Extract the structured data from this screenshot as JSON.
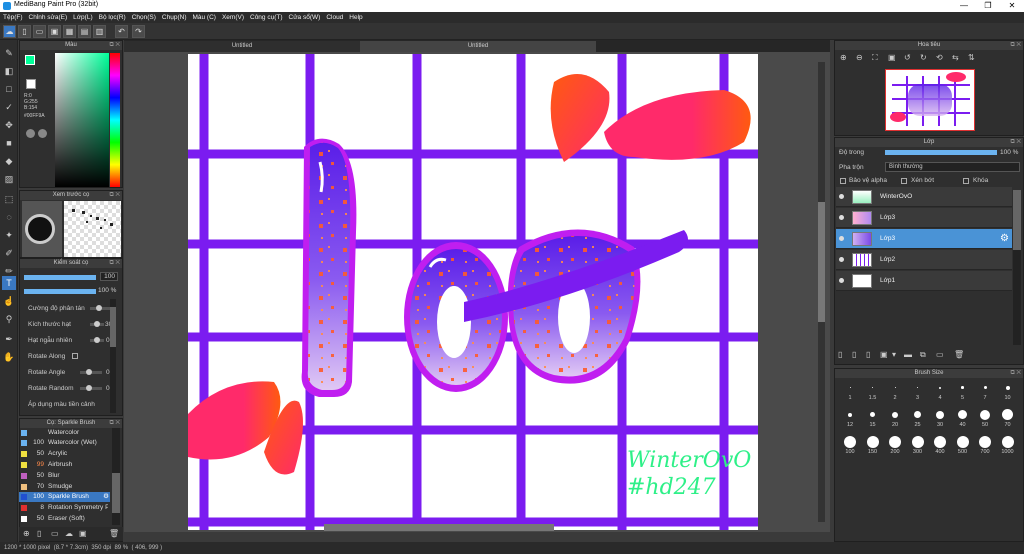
{
  "window": {
    "title": "MediBang Paint Pro (32bit)",
    "minimize": "—",
    "maximize": "❐",
    "close": "✕"
  },
  "menu": [
    "Tệp(F)",
    "Chỉnh sửa(E)",
    "Lớp(L)",
    "Bộ lọc(R)",
    "Chọn(S)",
    "Chụp(N)",
    "Màu (C)",
    "Xem(V)",
    "Công cụ(T)",
    "Cửa sổ(W)",
    "Cloud",
    "Help"
  ],
  "tabs": [
    "Untitled",
    "Untitled"
  ],
  "color_panel": {
    "title": "Màu",
    "r": "R:0",
    "g": "G:255",
    "b": "B:154",
    "hex": "#00FF9A"
  },
  "brush_preview": {
    "title": "Xem trước cọ"
  },
  "brush_control": {
    "title": "Kiểm soát cọ",
    "size_value": "100",
    "opacity_value": "100 %",
    "settings": [
      {
        "label": "Cường độ phân tán",
        "value": ""
      },
      {
        "label": "Kích thước hạt",
        "value": "30"
      },
      {
        "label": "Hạt ngẫu nhiên",
        "value": "0"
      },
      {
        "label": "Rotate Along",
        "value": ""
      },
      {
        "label": "Rotate Angle",
        "value": "0"
      },
      {
        "label": "Rotate Random",
        "value": "0"
      },
      {
        "label": "Áp dụng màu tiền cảnh",
        "value": ""
      }
    ]
  },
  "brush_list": {
    "title": "Cọ: Sparkle Brush",
    "items": [
      {
        "size": "",
        "name": "Watercolor",
        "color": "#6bb3f0"
      },
      {
        "size": "100",
        "name": "Watercolor (Wet)",
        "color": "#6bb3f0"
      },
      {
        "size": "50",
        "name": "Acrylic",
        "color": "#f0e040"
      },
      {
        "size": "99",
        "name": "Airbrush",
        "color": "#f0e040"
      },
      {
        "size": "50",
        "name": "Blur",
        "color": "#c060c0"
      },
      {
        "size": "70",
        "name": "Smudge",
        "color": "#f0c080"
      },
      {
        "size": "100",
        "name": "Sparkle Brush",
        "color": "#2050d0"
      },
      {
        "size": "8",
        "name": "Rotation Symmetry P",
        "color": "#e03030"
      },
      {
        "size": "50",
        "name": "Eraser (Soft)",
        "color": "#ffffff"
      }
    ]
  },
  "navigator": {
    "title": "Hoa tiêu"
  },
  "layers": {
    "title": "Lớp",
    "opacity_label": "Độ trong",
    "opacity_value": "100 %",
    "blend_label": "Pha trộn",
    "blend_value": "Bình thường",
    "protect_alpha": "Bảo vệ alpha",
    "clipping": "Xén bớt",
    "lock": "Khóa",
    "items": [
      {
        "name": "WinterOvO",
        "selected": false
      },
      {
        "name": "Lớp3",
        "selected": false
      },
      {
        "name": "Lớp3",
        "selected": true
      },
      {
        "name": "Lớp2",
        "selected": false
      },
      {
        "name": "Lớp1",
        "selected": false
      }
    ]
  },
  "brush_size": {
    "title": "Brush Size",
    "sizes": [
      "1",
      "1.5",
      "2",
      "3",
      "4",
      "5",
      "7",
      "10",
      "12",
      "15",
      "20",
      "25",
      "30",
      "40",
      "50",
      "70",
      "100",
      "150",
      "200",
      "300",
      "400",
      "500",
      "700",
      "1000"
    ]
  },
  "canvas_text": {
    "line1": "WinterOvO",
    "line2": "#hd247"
  },
  "status": {
    "dims": "1200 * 1000 pixel",
    "size": "(8.7 * 7.3cm)",
    "dpi": "350 dpi",
    "zoom": "89 %",
    "coords": "( 406, 999 )"
  },
  "colors": {
    "grid": "#7b1cf0",
    "accent": "#4a93d6",
    "letter_top": "#5a1ee8",
    "letter_bottom": "#d9b8f0",
    "petal_pink": "#ff2a6a",
    "petal_orange": "#ff5a10",
    "signature": "#2ef088"
  }
}
